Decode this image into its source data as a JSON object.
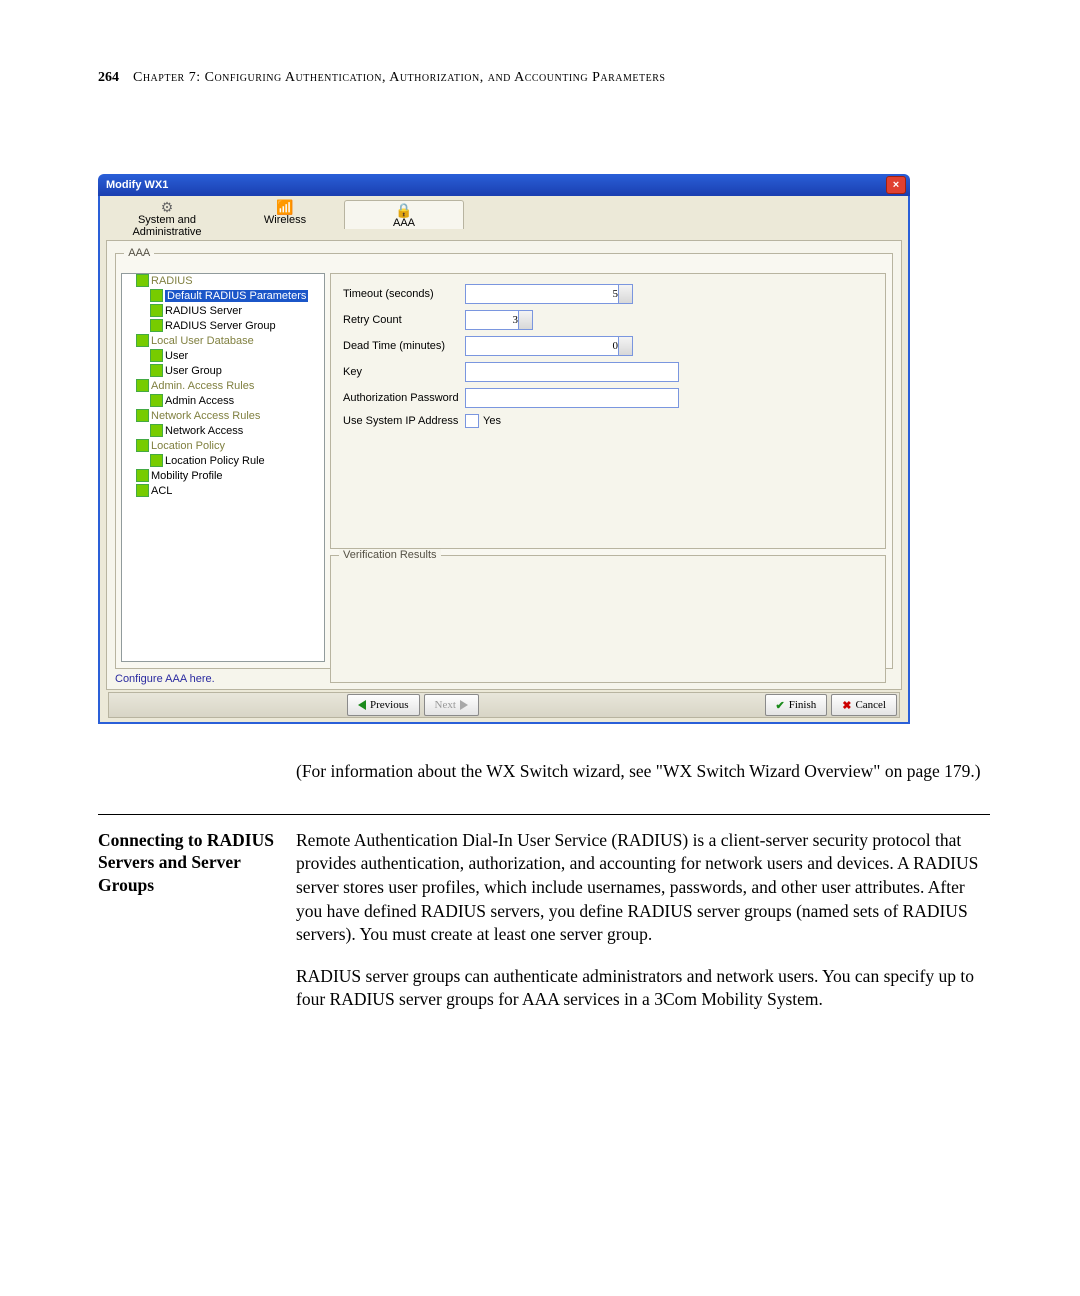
{
  "header": {
    "page_number": "264",
    "chapter": "Chapter 7: Configuring Authentication, Authorization, and Accounting Parameters"
  },
  "dialog": {
    "title": "Modify WX1",
    "tabs": {
      "system": "System and Administrative",
      "wireless": "Wireless",
      "aaa": "AAA"
    },
    "fieldset": "AAA",
    "tree": {
      "radius": "RADIUS",
      "default_params": "Default RADIUS Parameters",
      "radius_server": "RADIUS Server",
      "radius_server_group": "RADIUS Server Group",
      "local_db": "Local User Database",
      "user": "User",
      "user_group": "User Group",
      "admin_rules": "Admin. Access Rules",
      "admin_access": "Admin Access",
      "net_rules": "Network Access Rules",
      "network_access": "Network Access",
      "loc_policy": "Location Policy",
      "location_policy_rule": "Location Policy Rule",
      "mobility_profile": "Mobility Profile",
      "acl": "ACL"
    },
    "form": {
      "timeout_label": "Timeout (seconds)",
      "timeout_value": "5",
      "retry_label": "Retry Count",
      "retry_value": "3",
      "dead_label": "Dead Time (minutes)",
      "dead_value": "0",
      "key_label": "Key",
      "auth_pw_label": "Authorization Password",
      "use_ip_label": "Use System IP Address",
      "use_ip_value": "Yes"
    },
    "verification": "Verification Results",
    "status": "Configure AAA here.",
    "buttons": {
      "previous": "Previous",
      "next": "Next",
      "finish": "Finish",
      "cancel": "Cancel"
    }
  },
  "caption": "(For information about the WX Switch wizard, see \"WX Switch Wizard Overview\" on page 179.)",
  "section": {
    "heading": "Connecting to RADIUS Servers and Server Groups",
    "p1": "Remote Authentication Dial-In User Service (RADIUS) is a client-server security protocol that provides authentication, authorization, and accounting for network users and devices. A RADIUS server stores user profiles, which include usernames, passwords, and other user attributes. After you have defined RADIUS servers, you define RADIUS server groups (named sets of RADIUS servers). You must create at least one server group.",
    "p2": "RADIUS server groups can authenticate administrators and network users. You can specify up to four RADIUS server groups for AAA services in a 3Com Mobility System."
  }
}
